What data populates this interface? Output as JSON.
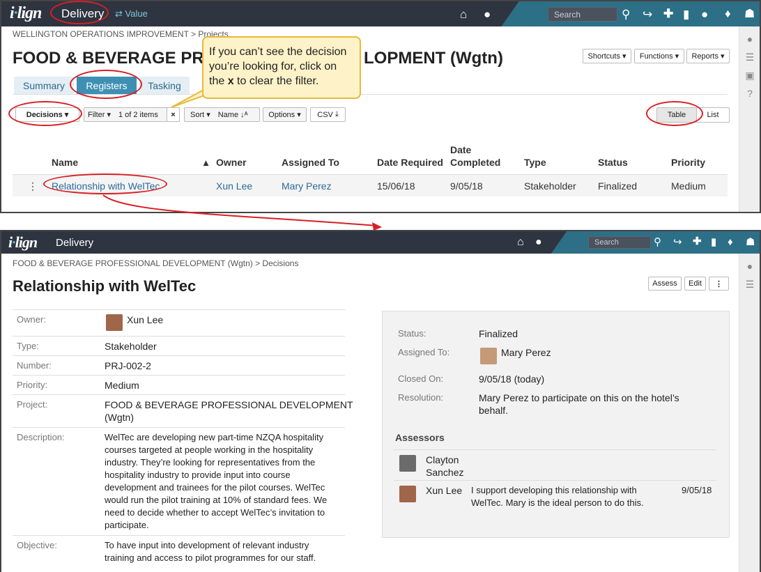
{
  "panel1": {
    "app_name": "Delivery",
    "switch_label": "Value",
    "search_placeholder": "Search",
    "breadcrumb": "WELLINGTON OPERATIONS IMPROVEMENT > Projects",
    "title_left": "FOOD & BEVERAGE PR",
    "title_right": "LOPMENT (Wgtn)",
    "header_buttons": {
      "shortcuts": "Shortcuts",
      "functions": "Functions",
      "reports": "Reports"
    },
    "tabs": [
      "Summary",
      "Registers",
      "Tasking"
    ],
    "toolbar": {
      "decisions": "Decisions",
      "filter": "Filter",
      "filter_count": "1 of 2 items",
      "clear": "×",
      "sort": "Sort",
      "sort_field": "Name",
      "options": "Options",
      "csv": "CSV"
    },
    "view_toggle": {
      "table": "Table",
      "list": "List"
    },
    "columns": {
      "name": "Name",
      "owner": "Owner",
      "assigned_to": "Assigned To",
      "date_required": "Date Required",
      "date_completed_1": "Date",
      "date_completed_2": "Completed",
      "type": "Type",
      "status": "Status",
      "priority": "Priority"
    },
    "row": {
      "name": "Relationship with WelTec",
      "owner": "Xun Lee",
      "assigned_to": "Mary Perez",
      "date_required": "15/06/18",
      "date_completed": "9/05/18",
      "type": "Stakeholder",
      "status": "Finalized",
      "priority": "Medium"
    },
    "callout": {
      "line1": "If you can’t see the decision",
      "line2": "you’re looking for, click on",
      "line3_pre": "the ",
      "line3_bold": "x",
      "line3_post": " to clear the filter."
    }
  },
  "panel2": {
    "app_name": "Delivery",
    "search_placeholder": "Search",
    "breadcrumb": "FOOD & BEVERAGE PROFESSIONAL DEVELOPMENT (Wgtn) > Decisions",
    "title": "Relationship with WelTec",
    "buttons": {
      "assess": "Assess",
      "edit": "Edit"
    },
    "fields": {
      "owner_label": "Owner:",
      "owner": "Xun Lee",
      "type_label": "Type:",
      "type": "Stakeholder",
      "number_label": "Number:",
      "number": "PRJ-002-2",
      "priority_label": "Priority:",
      "priority": "Medium",
      "project_label": "Project:",
      "project_1": "FOOD & BEVERAGE PROFESSIONAL DEVELOPMENT",
      "project_2": "(Wgtn)",
      "description_label": "Description:",
      "description": [
        "WelTec are developing new part-time NZQA hospitality",
        "courses targeted at people working in the hospitality",
        "industry. They’re looking for representatives from the",
        "hospitality industry to provide input into course",
        "development and trainees for the pilot courses. WelTec",
        "would run the pilot training at 10% of standard fees. We",
        "need to decide whether to accept WelTec’s invitation to",
        "participate."
      ],
      "objective_label": "Objective:",
      "objective": [
        "To have input into development of relevant industry",
        "training and access to pilot programmes for our staff."
      ]
    },
    "status_box": {
      "status_label": "Status:",
      "status": "Finalized",
      "assigned_label": "Assigned To:",
      "assigned": "Mary Perez",
      "closed_label": "Closed On:",
      "closed": "9/05/18 (today)",
      "resolution_label": "Resolution:",
      "resolution_1": "Mary Perez to participate on this on the hotel’s",
      "resolution_2": "behalf.",
      "assessors_heading": "Assessors",
      "assessor1_1": "Clayton",
      "assessor1_2": "Sanchez",
      "assessor2": "Xun Lee",
      "comment_1": "I support developing this relationship with",
      "comment_2": "WelTec. Mary is the ideal person to do this.",
      "comment_date": "9/05/18"
    }
  },
  "colors": {
    "topbar": "#2e3440",
    "accent": "#2c6f86",
    "link": "#2a6a9a",
    "highlight_oval": "#d81f26",
    "callout_bg": "#fdf2c8"
  }
}
